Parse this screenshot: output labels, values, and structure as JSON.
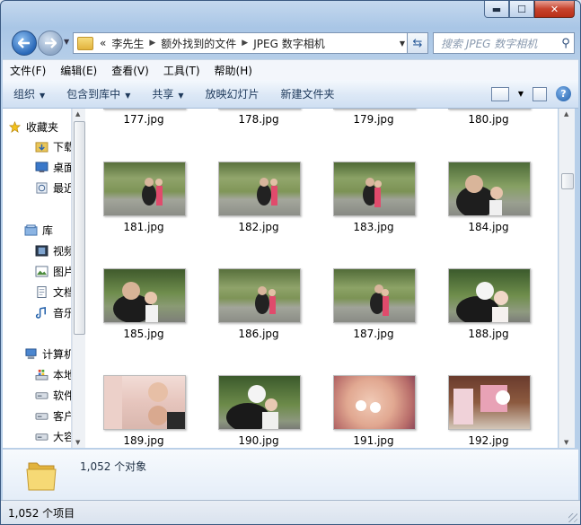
{
  "window": {
    "min_glyph": "▬",
    "max_glyph": "☐",
    "close_glyph": "✕"
  },
  "address": {
    "overflow": "«",
    "crumbs": [
      "李先生",
      "额外找到的文件",
      "JPEG 数字相机"
    ],
    "sep": "▶"
  },
  "search": {
    "placeholder": "搜索 JPEG 数字相机"
  },
  "menu": [
    "文件(F)",
    "编辑(E)",
    "查看(V)",
    "工具(T)",
    "帮助(H)"
  ],
  "toolbar": {
    "organize": "组织",
    "include": "包含到库中",
    "share": "共享",
    "slideshow": "放映幻灯片",
    "newfolder": "新建文件夹"
  },
  "nav": {
    "favorites": "收藏夹",
    "downloads": "下载",
    "desktop": "桌面",
    "recent": "最近访问的位置",
    "libraries": "库",
    "videos": "视频",
    "pictures": "图片",
    "documents": "文档",
    "music": "音乐",
    "computer": "计算机",
    "localdisk": "本地磁盘",
    "software": "软件",
    "guest": "客户",
    "big": "大容量"
  },
  "files_top": [
    "177.jpg",
    "178.jpg",
    "179.jpg",
    "180.jpg"
  ],
  "files": [
    [
      "181.jpg",
      "182.jpg",
      "183.jpg",
      "184.jpg"
    ],
    [
      "185.jpg",
      "186.jpg",
      "187.jpg",
      "188.jpg"
    ],
    [
      "189.jpg",
      "190.jpg",
      "191.jpg",
      "192.jpg"
    ]
  ],
  "details": {
    "count": "1,052 个对象"
  },
  "status": {
    "items": "1,052 个项目"
  }
}
